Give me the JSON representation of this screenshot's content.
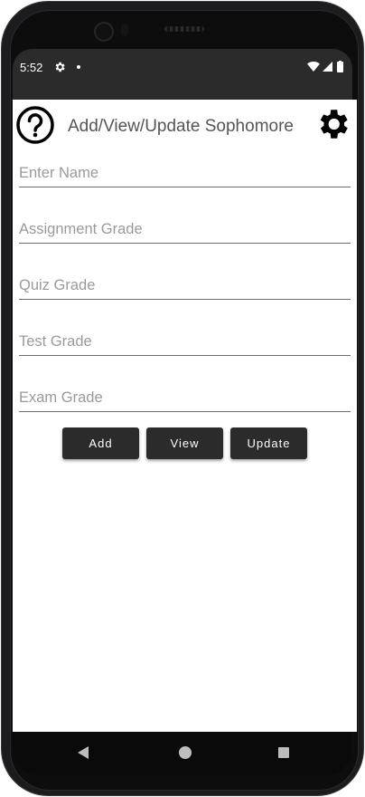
{
  "status_bar": {
    "time": "5:52",
    "icons": [
      "settings-gear-icon",
      "notification-dot",
      "wifi-icon",
      "cell-signal-icon",
      "battery-icon"
    ]
  },
  "header": {
    "title": "Add/View/Update Sophomore",
    "left_icon": "help-circle-icon",
    "right_icon": "settings-gear-icon"
  },
  "form": {
    "name_placeholder": "Enter Name",
    "assignment_placeholder": "Assignment Grade",
    "quiz_placeholder": "Quiz Grade",
    "test_placeholder": "Test Grade",
    "exam_placeholder": "Exam Grade"
  },
  "buttons": {
    "add_label": "Add",
    "view_label": "View",
    "update_label": "Update"
  },
  "nav": {
    "back_icon": "back-triangle-icon",
    "home_icon": "home-circle-icon",
    "recents_icon": "recents-square-icon"
  },
  "colors": {
    "button_bg": "#2b2b2b",
    "status_bar_bg": "#2b2b2b",
    "title_color": "#555555"
  }
}
